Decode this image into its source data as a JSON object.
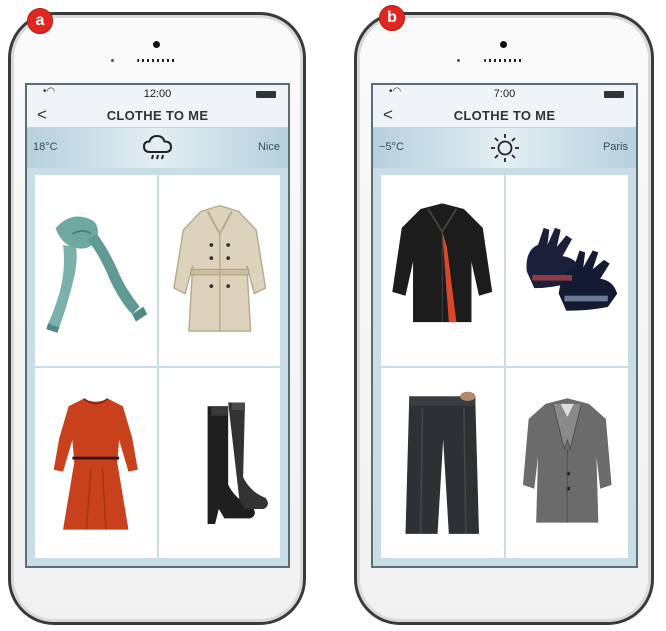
{
  "badges": {
    "a": "a",
    "b": "b"
  },
  "phone_a": {
    "status_time": "12:00",
    "app_title": "CLOTHE TO ME",
    "back_label": "<",
    "temperature": "18°C",
    "weather_icon": "rain-cloud-icon",
    "city": "Nice",
    "items": [
      "scarf",
      "trench-coat",
      "red-dress",
      "black-boots"
    ]
  },
  "phone_b": {
    "status_time": "7:00",
    "app_title": "CLOTHE TO ME",
    "back_label": "<",
    "temperature": "−5°C",
    "weather_icon": "sun-icon",
    "city": "Paris",
    "items": [
      "black-coat",
      "knit-gloves",
      "grey-trousers",
      "grey-blazer"
    ]
  },
  "colors": {
    "badge": "#e0271f",
    "screen_bg": "#c9dde7",
    "weather_bar": "#b6d0dd"
  }
}
